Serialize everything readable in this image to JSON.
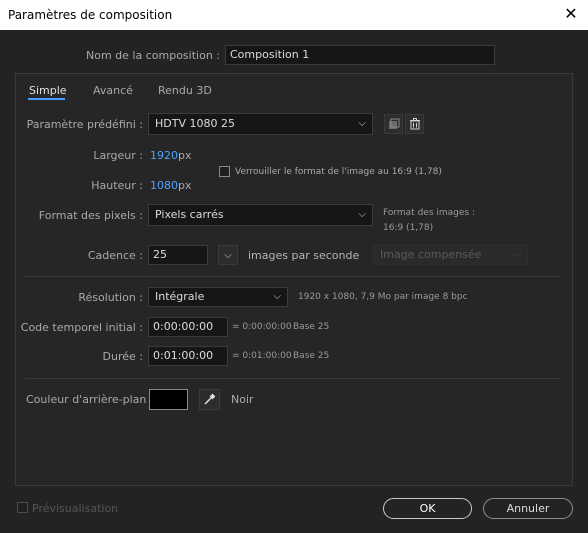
{
  "window": {
    "title": "Paramètres de composition",
    "close_glyph": "✕"
  },
  "comp_name": {
    "label": "Nom de la composition :",
    "value": "Composition 1"
  },
  "tabs": [
    {
      "label": "Simple",
      "active": true
    },
    {
      "label": "Avancé",
      "active": false
    },
    {
      "label": "Rendu 3D",
      "active": false
    }
  ],
  "preset": {
    "label": "Paramètre prédéfini :",
    "value": "HDTV 1080 25"
  },
  "width": {
    "label": "Largeur :",
    "value": "1920",
    "unit": "px"
  },
  "height": {
    "label": "Hauteur :",
    "value": "1080",
    "unit": "px"
  },
  "lock_aspect": {
    "label": "Verrouiller le format de l'image au 16:9 (1,78)",
    "checked": false
  },
  "pixel_aspect": {
    "label": "Format des pixels :",
    "value": "Pixels carrés"
  },
  "frame_aspect": {
    "label": "Format des images :",
    "value": "16:9 (1,78)"
  },
  "frame_rate": {
    "label": "Cadence :",
    "value": "25",
    "unit_label": "images par seconde",
    "dropdown_value": "Image compensée"
  },
  "resolution": {
    "label": "Résolution :",
    "value": "Intégrale",
    "info": "1920 x 1080, 7,9 Mo par image 8 bpc"
  },
  "start_timecode": {
    "label": "Code temporel initial :",
    "value": "0:00:00:00",
    "equiv": "= 0:00:00:00",
    "base": "Base 25"
  },
  "duration": {
    "label": "Durée :",
    "value": "0:01:00:00",
    "equiv": "= 0:01:00:00",
    "base": "Base 25"
  },
  "background_color": {
    "label": "Couleur d'arrière-plan :",
    "swatch": "#000000",
    "name": "Noir"
  },
  "preview": {
    "label": "Prévisualisation",
    "checked": false
  },
  "buttons": {
    "ok": "OK",
    "cancel": "Annuler"
  },
  "colors": {
    "accent": "#4a9bff",
    "value_blue": "#4da3ff",
    "bg": "#232323"
  }
}
